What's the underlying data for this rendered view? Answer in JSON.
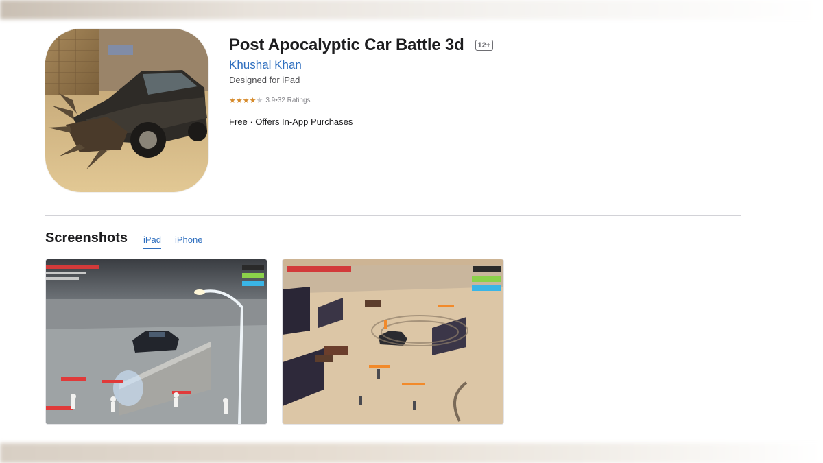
{
  "app": {
    "title": "Post Apocalyptic Car Battle 3d",
    "age_rating": "12+",
    "developer": "Khushal Khan",
    "designed_for": "Designed for iPad",
    "rating_value": "3.9",
    "rating_separator": " • ",
    "rating_count": "32 Ratings",
    "rating_stars": 3.9,
    "price": "Free · Offers In-App Purchases",
    "icon": "app-icon-car-image"
  },
  "screenshots": {
    "heading": "Screenshots",
    "tabs": [
      {
        "label": "iPad",
        "selected": true
      },
      {
        "label": "iPhone",
        "selected": false
      }
    ]
  },
  "colors": {
    "link": "#2f6fbf",
    "star": "#d68a2a",
    "text": "#1d1d1f"
  }
}
